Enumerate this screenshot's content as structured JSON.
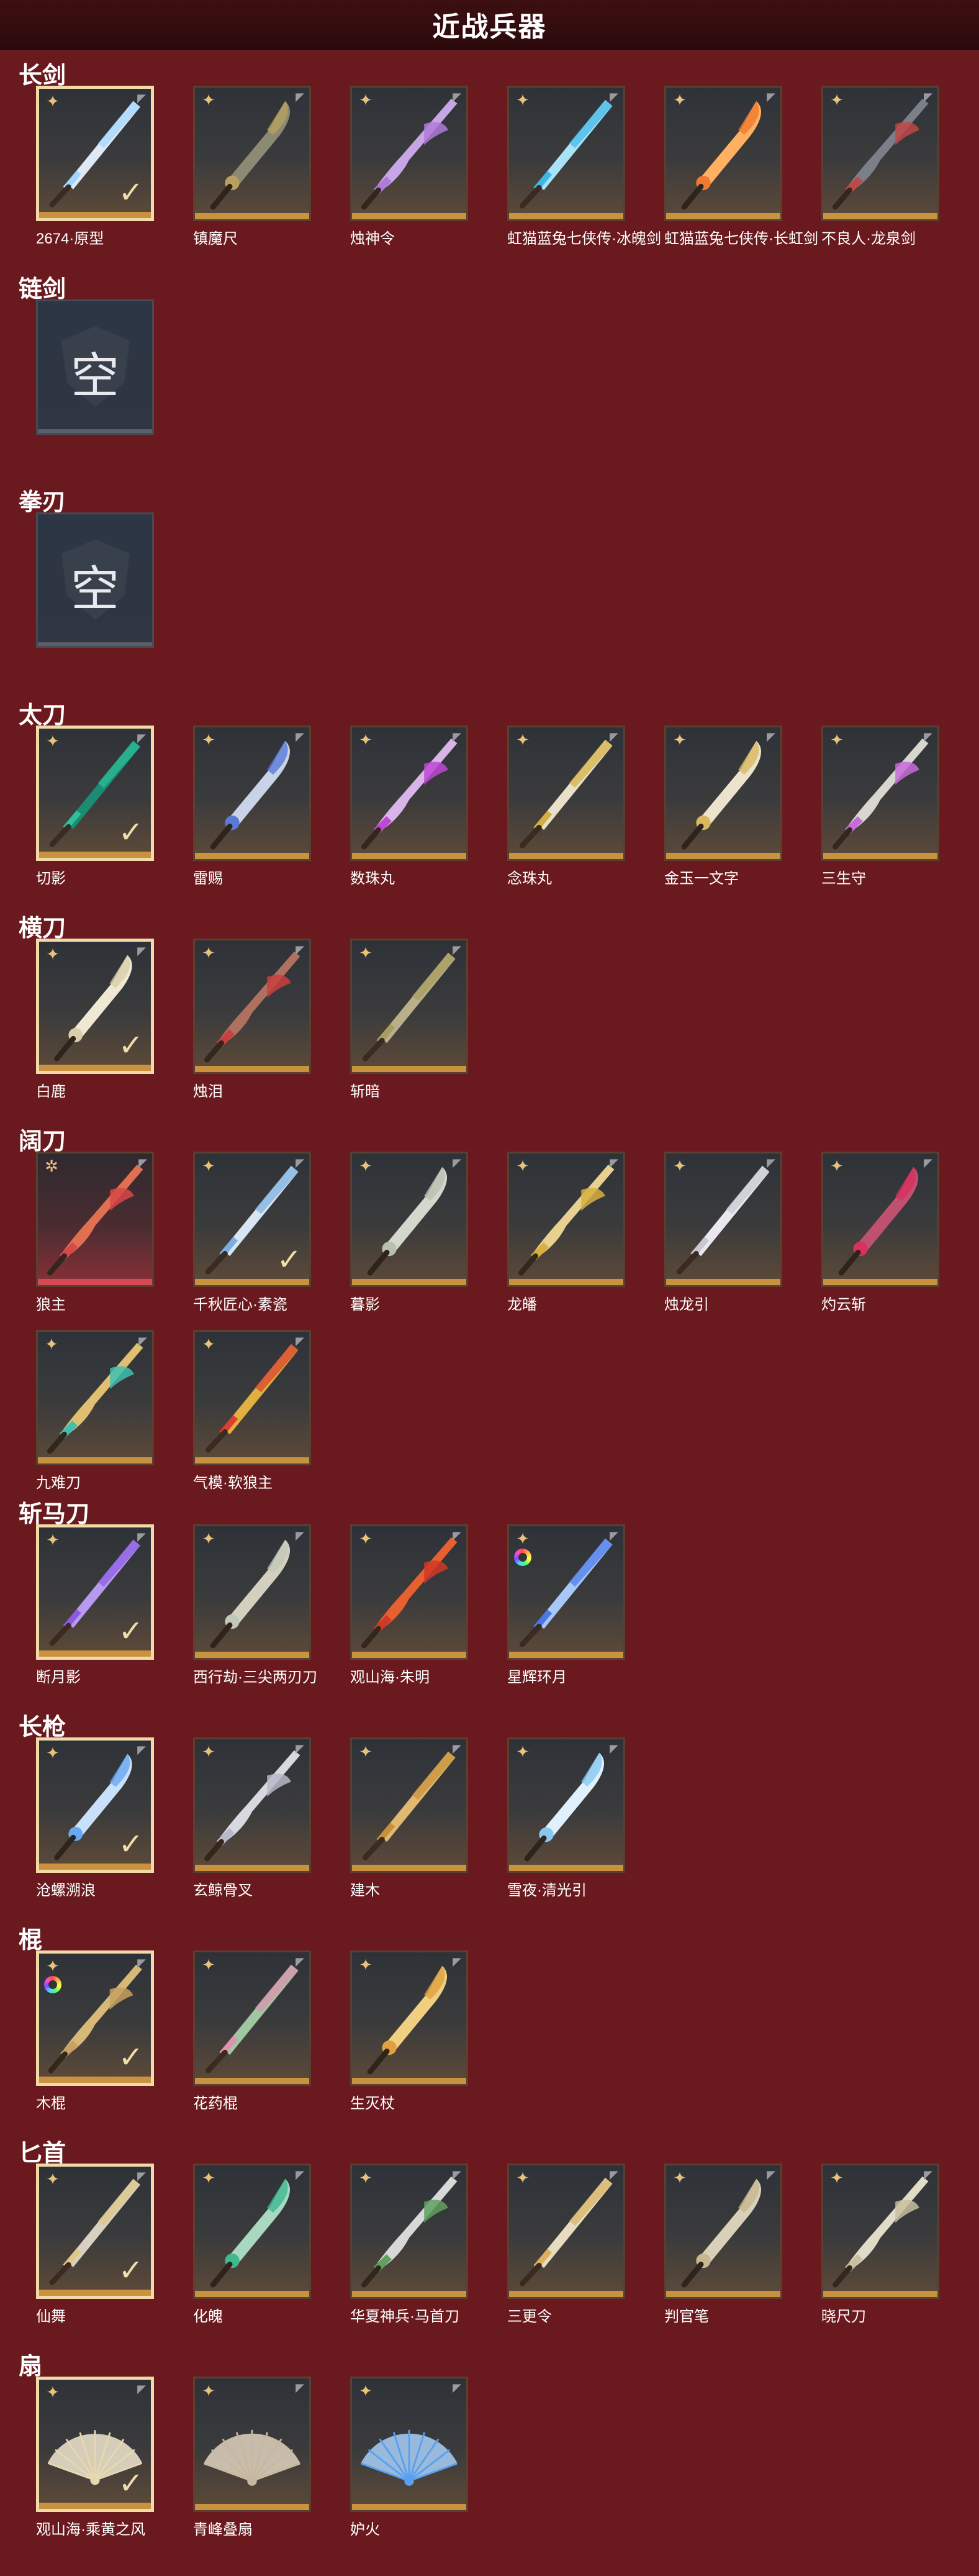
{
  "page_title": "近战兵器",
  "empty_label": "空",
  "sections": [
    {
      "id": "longsword",
      "title": "长剑",
      "items": [
        {
          "name": "2674·原型",
          "selected": true,
          "color": "#9fd4ff",
          "blade": "#dfe9f6"
        },
        {
          "name": "镇魔尺",
          "color": "#b8a060",
          "blade": "#8d8a74"
        },
        {
          "name": "烛神令",
          "color": "#b07ad8",
          "blade": "#c8a6e6"
        },
        {
          "name": "虹猫蓝兔七侠传·冰魄剑",
          "color": "#3fb6e6",
          "blade": "#a9e3f8"
        },
        {
          "name": "虹猫蓝兔七侠传·长虹剑",
          "color": "#f07a30",
          "blade": "#ffb060"
        },
        {
          "name": "不良人·龙泉剑",
          "color": "#c04848",
          "blade": "#7b7f88"
        }
      ]
    },
    {
      "id": "chainsword",
      "title": "链剑",
      "items": [
        {
          "empty": true
        }
      ]
    },
    {
      "id": "fistblade",
      "title": "拳刃",
      "items": [
        {
          "empty": true
        }
      ]
    },
    {
      "id": "taidao",
      "title": "太刀",
      "items": [
        {
          "name": "切影",
          "selected": true,
          "color": "#2fbf9a",
          "blade": "#1a8c74"
        },
        {
          "name": "雷赐",
          "color": "#5a7ad6",
          "blade": "#c9d3e8"
        },
        {
          "name": "数珠丸",
          "color": "#c048d6",
          "blade": "#d8b4e8"
        },
        {
          "name": "念珠丸",
          "color": "#d4b040",
          "blade": "#e8e0c8"
        },
        {
          "name": "金玉一文字",
          "color": "#d9b860",
          "blade": "#ece3cc"
        },
        {
          "name": "三生守",
          "color": "#c86ad8",
          "blade": "#d9d6d0"
        }
      ]
    },
    {
      "id": "hengdao",
      "title": "横刀",
      "items": [
        {
          "name": "白鹿",
          "selected": true,
          "color": "#d8cfa8",
          "blade": "#efe8d2"
        },
        {
          "name": "烛泪",
          "color": "#c84040",
          "blade": "#b07060"
        },
        {
          "name": "斩暗",
          "color": "#a89c60",
          "blade": "#b9b08a"
        }
      ]
    },
    {
      "id": "kuodao",
      "title": "阔刀",
      "items": [
        {
          "name": "狼主",
          "color": "#d84848",
          "blade": "#e07050",
          "red": true
        },
        {
          "name": "千秋匠心·素瓷",
          "color": "#7aaee0",
          "blade": "#d8e6f4",
          "selected_check": true
        },
        {
          "name": "暮影",
          "color": "#b8c0b0",
          "blade": "#d4d8cc"
        },
        {
          "name": "龙皤",
          "color": "#d6b040",
          "blade": "#e8d090"
        },
        {
          "name": "烛龙引",
          "color": "#c8c8d0",
          "blade": "#e8e8ee"
        },
        {
          "name": "灼云斩",
          "color": "#d83060",
          "blade": "#c05070"
        },
        {
          "name": "九难刀",
          "color": "#40c0b0",
          "blade": "#e0c070"
        },
        {
          "name": "气模·软狼主",
          "color": "#d84030",
          "blade": "#e0b040"
        }
      ]
    },
    {
      "id": "zhanmadao",
      "title": "斩马刀",
      "items": [
        {
          "name": "断月影",
          "selected": true,
          "color": "#8a5ae0",
          "blade": "#b79af0"
        },
        {
          "name": "西行劫·三尖两刃刀",
          "color": "#c0c8b8",
          "blade": "#d4d0c0"
        },
        {
          "name": "观山海·朱明",
          "color": "#d03828",
          "blade": "#e86030"
        },
        {
          "name": "星辉环月",
          "color": "#4878e8",
          "blade": "#a8c8f8",
          "rainbow": true
        }
      ]
    },
    {
      "id": "spear",
      "title": "长枪",
      "items": [
        {
          "name": "沧螺溯浪",
          "selected": true,
          "color": "#6aa8f0",
          "blade": "#c8e0fa"
        },
        {
          "name": "玄鲸骨叉",
          "color": "#b8b8c8",
          "blade": "#d8d8e0"
        },
        {
          "name": "建木",
          "color": "#c8903a",
          "blade": "#e0b870"
        },
        {
          "name": "雪夜·清光引",
          "color": "#88c8f0",
          "blade": "#e0f0fc"
        }
      ]
    },
    {
      "id": "staff",
      "title": "棍",
      "items": [
        {
          "name": "木棍",
          "selected": true,
          "rainbow": true,
          "color": "#c8a060",
          "blade": "#d8b878"
        },
        {
          "name": "花药棍",
          "color": "#e090b0",
          "blade": "#a0c8a0"
        },
        {
          "name": "生灭杖",
          "color": "#e0a040",
          "blade": "#f0d080"
        }
      ]
    },
    {
      "id": "dagger",
      "title": "匕首",
      "items": [
        {
          "name": "仙舞",
          "selected": true,
          "color": "#e0c888",
          "blade": "#d8d0c0"
        },
        {
          "name": "化魄",
          "color": "#40b890",
          "blade": "#a8d8c0"
        },
        {
          "name": "华夏神兵·马首刀",
          "color": "#60a060",
          "blade": "#d8d8d8"
        },
        {
          "name": "三更令",
          "color": "#d8b060",
          "blade": "#e8dcc0"
        },
        {
          "name": "判官笔",
          "color": "#c8b890",
          "blade": "#d8d0b8"
        },
        {
          "name": "晓尺刀",
          "color": "#c8c0a0",
          "blade": "#e0dcc8"
        }
      ]
    },
    {
      "id": "fan",
      "title": "扇",
      "items": [
        {
          "name": "观山海·乘黄之风",
          "selected": true,
          "color": "#e8d8b0",
          "blade": "#f0e8d0",
          "fan": true
        },
        {
          "name": "青峰叠扇",
          "color": "#c8b8a0",
          "blade": "#e0d4c0",
          "fan": true
        },
        {
          "name": "妒火",
          "color": "#5aa0f0",
          "blade": "#a8d0f8",
          "fan": true
        }
      ]
    }
  ]
}
